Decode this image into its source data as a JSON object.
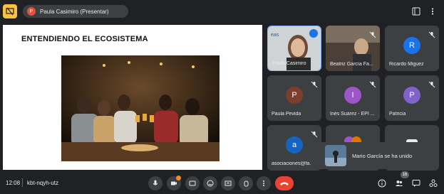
{
  "topbar": {
    "presenter_avatar": "P",
    "presenter_label": "Paula Casimiro (Presentar)"
  },
  "slide": {
    "title": "ENTENDIENDO EL ECOSISTEMA"
  },
  "participants": [
    {
      "name": "Paula Casimiro",
      "type": "video"
    },
    {
      "name": "Beatriz García Fa...",
      "type": "video"
    },
    {
      "name": "Ricardo Miguez",
      "avatar": "R",
      "color": "#1a73e8"
    },
    {
      "name": "Paula Pevida",
      "avatar": "P",
      "color": "#7b3f2e"
    },
    {
      "name": "Inés Suárez - EPI ...",
      "avatar": "I",
      "color": "#9c56c8"
    },
    {
      "name": "Patricia",
      "avatar": "P",
      "color": "#8062c8"
    },
    {
      "name": "asociaciones@fa...",
      "avatar": "a",
      "color": "#1565c0"
    }
  ],
  "notification": {
    "text": "Mario García se ha unido"
  },
  "bottombar": {
    "time": "12:08",
    "meeting_code": "kbt-nqyh-utz",
    "participant_count": "16"
  },
  "colors": {
    "background": "#202124",
    "tile": "#3c4043",
    "hangup": "#ea4335",
    "active_speaker": "#1a73e8"
  }
}
